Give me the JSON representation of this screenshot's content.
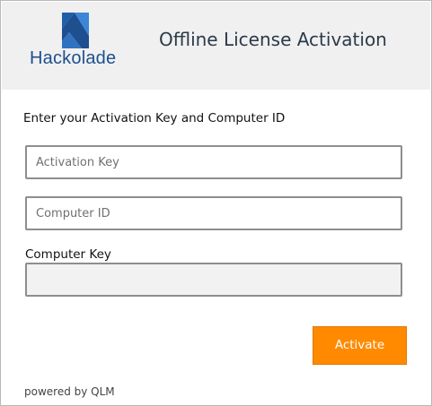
{
  "header": {
    "logo_text": "Hackolade",
    "title": "Offline License Activation"
  },
  "form": {
    "instruction": "Enter your Activation Key and Computer ID",
    "activation_key": {
      "value": "",
      "placeholder": "Activation Key"
    },
    "computer_id": {
      "value": "",
      "placeholder": "Computer ID"
    },
    "computer_key": {
      "label": "Computer Key",
      "value": ""
    },
    "activate_label": "Activate"
  },
  "footer": {
    "powered_by": "powered by QLM"
  },
  "colors": {
    "header_bg": "#f0f0f0",
    "brand_blue": "#1e4f8f",
    "accent_orange": "#ff8a00"
  },
  "icons": {
    "logo": "hackolade-logo-icon"
  }
}
